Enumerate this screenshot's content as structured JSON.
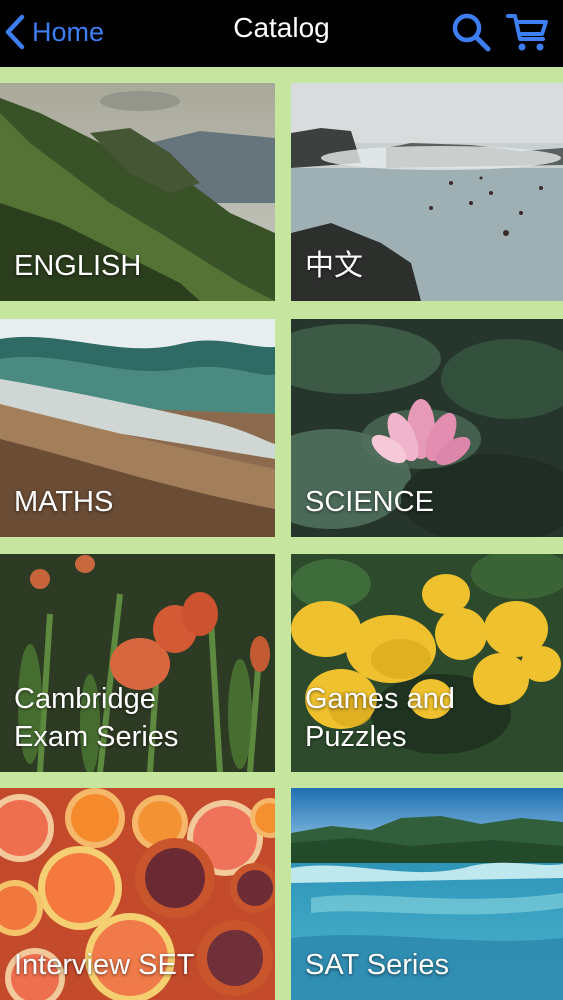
{
  "nav": {
    "back_label": "Home",
    "title": "Catalog",
    "search_icon": "search-icon",
    "cart_icon": "cart-icon"
  },
  "tiles": [
    {
      "label": "ENGLISH",
      "image": "mountain valley landscape"
    },
    {
      "label": "中文",
      "image": "lagoon with swimmers in steam"
    },
    {
      "label": "MATHS",
      "image": "ocean wave on sandy beach"
    },
    {
      "label": "SCIENCE",
      "image": "pink lotus flower"
    },
    {
      "label": "Cambridge\nExam Series",
      "image": "orange tulips"
    },
    {
      "label": "Games and\nPuzzles",
      "image": "lemons on tree"
    },
    {
      "label": "Interview SET",
      "image": "sliced grapefruit and oranges"
    },
    {
      "label": "SAT Series",
      "image": "tropical bay with islands"
    }
  ],
  "colors": {
    "background": "#c6e6a0",
    "navbar": "#000000",
    "accent": "#3d7ef2",
    "title": "#ffffff"
  }
}
